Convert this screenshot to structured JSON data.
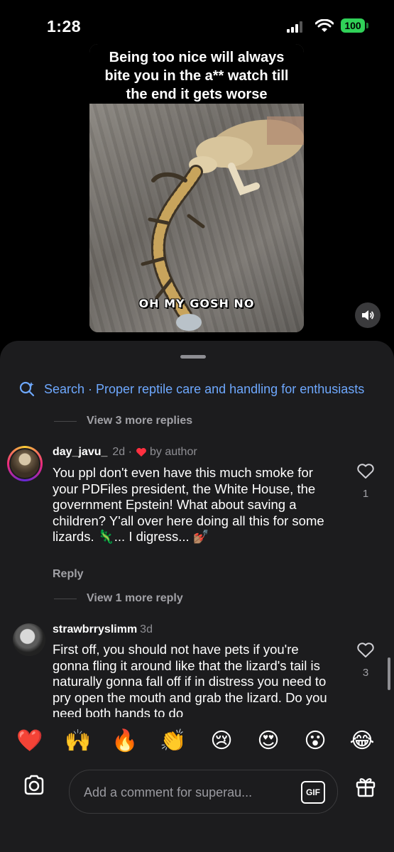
{
  "status_bar": {
    "time": "1:28",
    "battery": "100"
  },
  "video": {
    "caption_top": "Being too nice will always bite you in the a** watch till the end it gets worse",
    "caption_bottom": "OH MY GOSH NO"
  },
  "comments_sheet": {
    "search_text": "Search · Proper reptile care and handling for enthusiasts",
    "view_more_1": "View 3 more replies",
    "comments": [
      {
        "username": "day_javu_",
        "age": "2d ·",
        "by_author": "by author",
        "text": "You ppl don't even have this much smoke for your PDFiles president, the White House, the government Epstein! What about saving a children? Y'all over here doing all this for some lizards. 🦎... I digress... 💅🏽",
        "likes": "1",
        "reply_label": "Reply"
      },
      {
        "username": "strawbrryslimm",
        "age": "3d",
        "text": "First off, you should not have pets if you're gonna fling it around like that the lizard's tail is naturally gonna fall off if in distress you need to pry open the mouth and grab the lizard. Do you need both hands to do",
        "likes": "3"
      }
    ],
    "view_more_2": "View 1 more reply"
  },
  "emoji_bar": [
    "❤️",
    "🙌",
    "🔥",
    "👏",
    "😢",
    "😍",
    "😮",
    "😂"
  ],
  "composer": {
    "placeholder": "Add a comment for superau...",
    "gif_label": "GIF"
  },
  "colors": {
    "link_blue": "#6ea8fe",
    "sheet_bg": "#1c1c1e",
    "battery_green": "#30d158",
    "heart_red": "#ff3040"
  }
}
